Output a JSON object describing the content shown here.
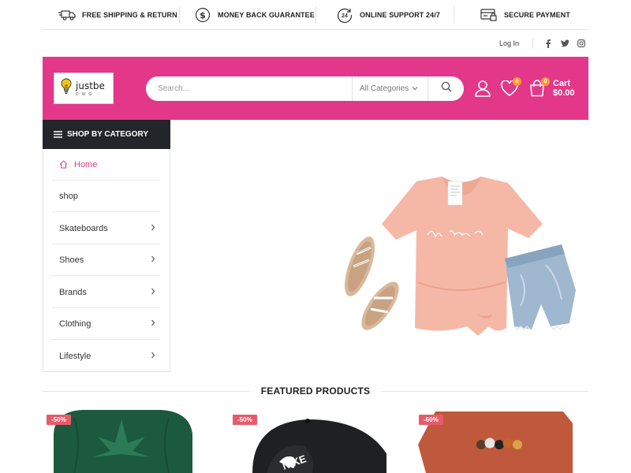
{
  "benefits": {
    "items": [
      {
        "icon": "truck-icon",
        "label": "FREE SHIPPING & RETURN"
      },
      {
        "icon": "dollar-icon",
        "label": "MONEY BACK GUARANTEE"
      },
      {
        "icon": "support-24-icon",
        "label": "ONLINE SUPPORT 24/7"
      },
      {
        "icon": "secure-payment-icon",
        "label": "SECURE PAYMENT"
      }
    ],
    "support_badge": "24"
  },
  "utility": {
    "login_label": "Log In",
    "social": [
      "facebook-icon",
      "twitter-icon",
      "instagram-icon"
    ]
  },
  "header": {
    "background": "#e3388a",
    "logo_name": "justbe",
    "logo_sub": "DWG",
    "search_placeholder": "Search...",
    "category_select": "All Categories",
    "wishlist_count": "0",
    "cart_count": "0",
    "cart_label": "Cart",
    "cart_total": "$0.00"
  },
  "sidebar": {
    "heading": "SHOP BY CATEGORY",
    "items": [
      {
        "label": "Home",
        "has_arrow": false,
        "active": true
      },
      {
        "label": "shop",
        "has_arrow": false,
        "active": false
      },
      {
        "label": "Skateboards",
        "has_arrow": true,
        "active": false
      },
      {
        "label": "Shoes",
        "has_arrow": true,
        "active": false
      },
      {
        "label": "Brands",
        "has_arrow": true,
        "active": false
      },
      {
        "label": "Clothing",
        "has_arrow": true,
        "active": false
      },
      {
        "label": "Lifestyle",
        "has_arrow": true,
        "active": false
      }
    ]
  },
  "featured": {
    "title": "FEATURED PRODUCTS",
    "products": [
      {
        "discount": "-50%",
        "image": "green-beanie"
      },
      {
        "discount": "-50%",
        "image": "black-cap"
      },
      {
        "discount": "-60%",
        "image": "orange-tee"
      }
    ]
  }
}
